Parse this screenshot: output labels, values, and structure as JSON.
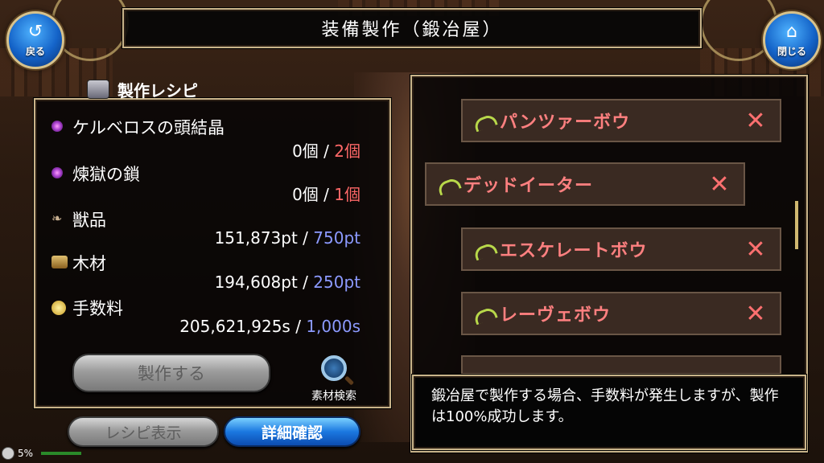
{
  "title": "装備製作（鍛冶屋）",
  "back_button": {
    "label": "戻る",
    "icon": "back-arrow-icon"
  },
  "close_button": {
    "label": "閉じる",
    "icon": "home-icon"
  },
  "recipe": {
    "header": "製作レシピ",
    "materials": [
      {
        "name": "ケルベロスの頭結晶",
        "have": "0個",
        "sep": "/",
        "need": "2個",
        "need_color": "#ff6868",
        "icon": "purple-gem-icon"
      },
      {
        "name": "煉獄の鎖",
        "have": "0個",
        "sep": "/",
        "need": "1個",
        "need_color": "#ff6868",
        "icon": "purple-gem-icon"
      },
      {
        "name": "獣品",
        "have": "151,873pt",
        "sep": "/",
        "need": "750pt",
        "need_color": "#8c9aff",
        "icon": "fang-icon"
      },
      {
        "name": "木材",
        "have": "194,608pt",
        "sep": "/",
        "need": "250pt",
        "need_color": "#8c9aff",
        "icon": "wood-icon"
      },
      {
        "name": "手数料",
        "have": "205,621,925s",
        "sep": "/",
        "need": "1,000s",
        "need_color": "#8c9aff",
        "icon": "coins-icon"
      }
    ],
    "craft_button": "製作する",
    "search_label": "素材検索"
  },
  "bottom_buttons": {
    "recipe_view": "レシピ表示",
    "details": "詳細確認"
  },
  "list": [
    {
      "name": "パンツァーボウ",
      "mark": "✕"
    },
    {
      "name": "デッドイーター",
      "mark": "✕"
    },
    {
      "name": "エスケレートボウ",
      "mark": "✕"
    },
    {
      "name": "レーヴェボウ",
      "mark": "✕"
    }
  ],
  "description": "鍛冶屋で製作する場合、手数料が発生しますが、製作は100%成功します。",
  "status": {
    "battery": "5%"
  }
}
